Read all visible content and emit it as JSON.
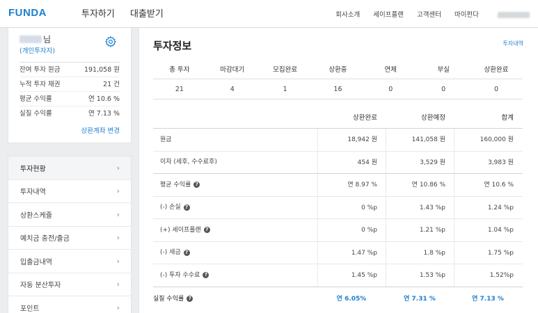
{
  "header": {
    "logo": "FUNDA",
    "main_nav": [
      "투자하기",
      "대출받기"
    ],
    "sub_nav": [
      "회사소개",
      "세이프플랜",
      "고객센터",
      "마이펀다"
    ]
  },
  "profile": {
    "suffix": "님",
    "type": "(개인투자자)",
    "stats": [
      {
        "label": "잔여 투자 원금",
        "value": "191,058 원"
      },
      {
        "label": "누적 투자 채권",
        "value": "21 건"
      },
      {
        "label": "평균 수익률",
        "value": "연 10.6 %"
      },
      {
        "label": "실질 수익률",
        "value": "연 7.13 %"
      }
    ],
    "change_link": "상환계좌 변경"
  },
  "menu": [
    {
      "label": "투자현황",
      "active": true
    },
    {
      "label": "투자내역"
    },
    {
      "label": "상환스케쥴"
    },
    {
      "label": "예치금 충전/출금"
    },
    {
      "label": "입출금내역"
    },
    {
      "label": "자동 분산투자"
    },
    {
      "label": "포인트"
    }
  ],
  "main": {
    "title": "투자정보",
    "history_link": "투자내역",
    "summary": {
      "headers": [
        "총 투자",
        "마감대기",
        "모집완료",
        "상환중",
        "연체",
        "부실",
        "상환완료"
      ],
      "values": [
        "21",
        "4",
        "1",
        "16",
        "0",
        "0",
        "0"
      ]
    },
    "detail": {
      "headers": [
        "상환완료",
        "상환예정",
        "합계"
      ],
      "rows": [
        {
          "label": "원금",
          "values": [
            "18,942 원",
            "141,058 원",
            "160,000 원"
          ]
        },
        {
          "label": "이자 (세후, 수수료후)",
          "values": [
            "454 원",
            "3,529 원",
            "3,983 원"
          ]
        },
        {
          "label": "평균 수익률",
          "help": true,
          "values": [
            "연 8.97 %",
            "연 10.86 %",
            "연 10.6 %"
          ]
        },
        {
          "label": "(-) 손실",
          "help": true,
          "values": [
            "0 %p",
            "1.43 %p",
            "1.24 %p"
          ]
        },
        {
          "label": "(+) 세이프플랜",
          "help": true,
          "values": [
            "0 %p",
            "1.21 %p",
            "1.04 %p"
          ]
        },
        {
          "label": "(-) 세금",
          "help": true,
          "values": [
            "1.47 %p",
            "1.8 %p",
            "1.75 %p"
          ]
        },
        {
          "label": "(-) 투자 수수료",
          "help": true,
          "values": [
            "1.45 %p",
            "1.53 %p",
            "1.52%p"
          ]
        }
      ],
      "total": {
        "label": "실질 수익률",
        "help": true,
        "values": [
          "연 6.05%",
          "연 7.31 %",
          "연 7.13 %"
        ]
      }
    }
  },
  "colors": {
    "accent": "#1d7fd0"
  }
}
